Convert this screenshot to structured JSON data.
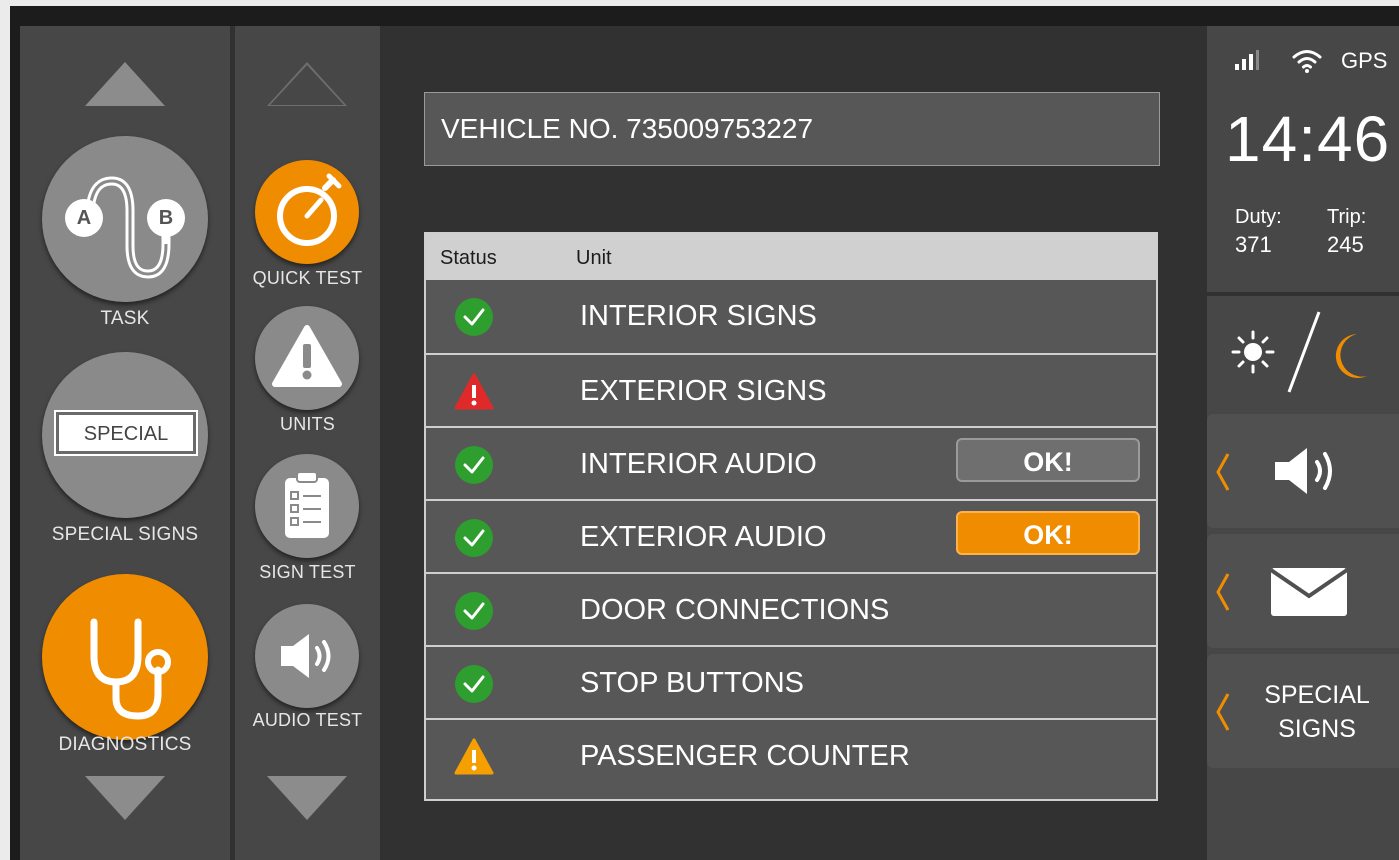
{
  "nav": {
    "task_label": "TASK",
    "special_signs_label": "SPECIAL SIGNS",
    "special_badge": "SPECIAL",
    "diagnostics_label": "DIAGNOSTICS",
    "task_a": "A",
    "task_b": "B"
  },
  "subnav": {
    "quick_test_label": "QUICK TEST",
    "units_label": "UNITS",
    "sign_test_label": "SIGN TEST",
    "audio_test_label": "AUDIO TEST"
  },
  "vehicle": {
    "title": "VEHICLE NO. 735009753227"
  },
  "table": {
    "header_status": "Status",
    "header_unit": "Unit",
    "rows": [
      {
        "unit": "INTERIOR SIGNS",
        "status": "ok"
      },
      {
        "unit": "EXTERIOR SIGNS",
        "status": "error"
      },
      {
        "unit": "INTERIOR AUDIO",
        "status": "ok",
        "button": "OK!"
      },
      {
        "unit": "EXTERIOR AUDIO",
        "status": "ok",
        "button": "OK!"
      },
      {
        "unit": "DOOR CONNECTIONS",
        "status": "ok"
      },
      {
        "unit": "STOP BUTTONS",
        "status": "ok"
      },
      {
        "unit": "PASSENGER COUNTER",
        "status": "warning"
      }
    ]
  },
  "status_panel": {
    "gps": "GPS",
    "time": "14:46",
    "duty_label": "Duty:",
    "duty_value": "371",
    "trip_label": "Trip:",
    "trip_value": "245",
    "special_signs_line1": "SPECIAL",
    "special_signs_line2": "SIGNS"
  },
  "colors": {
    "accent": "#f08c00",
    "ok": "#2e9e2e",
    "error": "#e02a2a",
    "warning": "#f5a000"
  }
}
